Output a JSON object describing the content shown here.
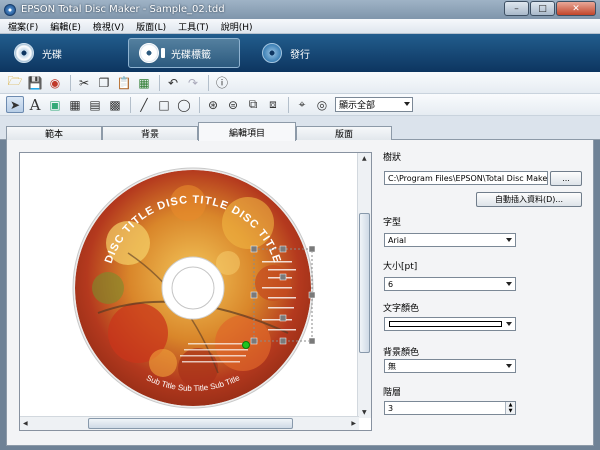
{
  "window": {
    "title": "EPSON Total Disc Maker - Sample_02.tdd",
    "min_label": "–",
    "max_label": "□",
    "close_label": "✕"
  },
  "menu": [
    "檔案(F)",
    "編輯(E)",
    "檢視(V)",
    "版面(L)",
    "工具(T)",
    "說明(H)"
  ],
  "modes": [
    {
      "label": "光碟",
      "icon": "disc-icon"
    },
    {
      "label": "光碟標籤",
      "icon": "disc-label-icon",
      "active": true
    },
    {
      "label": "發行",
      "icon": "publish-icon"
    }
  ],
  "toolbar": {
    "display_select": "顯示全部"
  },
  "tabs": [
    {
      "label": "範本"
    },
    {
      "label": "背景"
    },
    {
      "label": "編輯項目",
      "active": true
    },
    {
      "label": "版面"
    }
  ],
  "disc": {
    "arc_title": "DISC TITLE DISC TITLE DISC TITLE",
    "arc_subtitle": "Sub Title Sub Title Sub Title"
  },
  "properties": {
    "shape_label": "樹狀",
    "path_value": "C:\\Program Files\\EPSON\\Total Disc Maker",
    "browse_label": "...",
    "auto_insert_label": "自動插入資料(D)...",
    "font_label": "字型",
    "font_value": "Arial",
    "size_label": "大小[pt]",
    "size_value": "6",
    "text_color_label": "文字顏色",
    "bg_color_label": "背景顏色",
    "bg_color_value": "無",
    "layer_label": "階層",
    "layer_value": "3"
  },
  "colors": {
    "mode_bar": "#0d3560",
    "handle": "#7a7a7a",
    "handle_green": "#1ec41e"
  }
}
